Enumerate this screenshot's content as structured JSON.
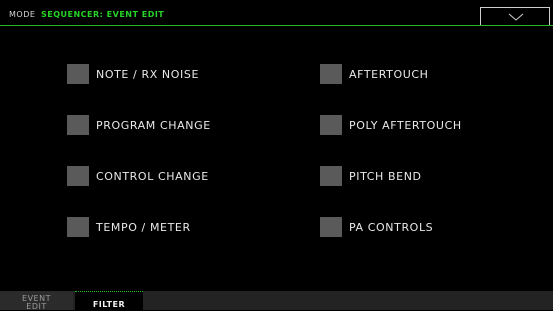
{
  "header": {
    "mode_label": "MODE",
    "page_title": "SEQUENCER: EVENT EDIT",
    "menu_icon": "chevron-down-icon"
  },
  "filters": {
    "left": [
      {
        "label": "NOTE / RX NOISE",
        "checked": false
      },
      {
        "label": "PROGRAM CHANGE",
        "checked": false
      },
      {
        "label": "CONTROL CHANGE",
        "checked": false
      },
      {
        "label": "TEMPO / METER",
        "checked": false
      }
    ],
    "right": [
      {
        "label": "AFTERTOUCH",
        "checked": false
      },
      {
        "label": "POLY AFTERTOUCH",
        "checked": false
      },
      {
        "label": "PITCH BEND",
        "checked": false
      },
      {
        "label": "PA CONTROLS",
        "checked": false
      }
    ]
  },
  "tabs": [
    {
      "label_line1": "EVENT",
      "label_line2": "EDIT",
      "active": false
    },
    {
      "label": "FILTER",
      "active": true
    }
  ],
  "colors": {
    "accent_green": "#26d326",
    "checkbox": "#5a5a5a",
    "background": "#000000"
  }
}
